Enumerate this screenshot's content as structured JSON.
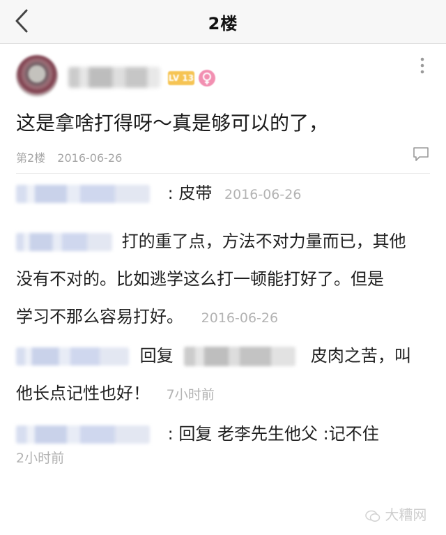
{
  "header": {
    "title": "2楼"
  },
  "post": {
    "level_badge": "LV 13",
    "content": "这是拿啥打得呀～真是够可以的了，",
    "floor": "第2楼",
    "date": "2016-06-26"
  },
  "replies": [
    {
      "text": ": 皮带",
      "time": "2016-06-26"
    },
    {
      "text_line1": "打的重了点，方法不对力量而已，其他",
      "text_line2": "没有不对的。比如逃学这么打一顿能打好了。但是",
      "text_line3": "学习不那么容易打好。",
      "time": "2016-06-26"
    },
    {
      "reply_prefix": "回复",
      "text_line1": "皮肉之苦，叫",
      "text_line2": "他长点记性也好！",
      "time": "7小时前"
    },
    {
      "text": ": 回复 老李先生他父 :记不住",
      "time": "2小时前"
    }
  ],
  "watermark": "大糟网",
  "icons": [
    "back-arrow-icon",
    "more-vertical-icon",
    "comment-icon",
    "female-icon",
    "wechat-icon"
  ]
}
